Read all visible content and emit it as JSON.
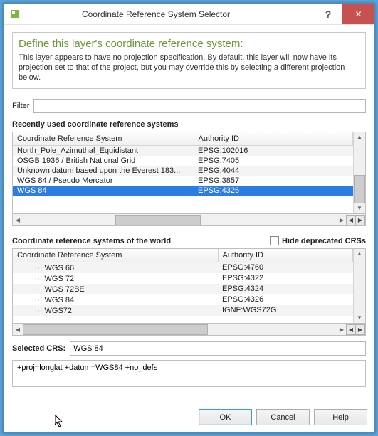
{
  "window": {
    "title": "Coordinate Reference System Selector"
  },
  "panel": {
    "title": "Define this layer's coordinate reference system:",
    "body": "This layer appears to have no projection specification. By default, this layer will now have its projection set to that of the project, but you may override this by selecting a different projection below."
  },
  "filter": {
    "label": "Filter",
    "value": ""
  },
  "recent": {
    "heading": "Recently used coordinate reference systems",
    "cols": {
      "crs": "Coordinate Reference System",
      "auth": "Authority ID"
    },
    "rows": [
      {
        "crs": "North_Pole_Azimuthal_Equidistant",
        "auth": "EPSG:102016",
        "selected": false
      },
      {
        "crs": "OSGB 1936 / British National Grid",
        "auth": "EPSG:7405",
        "selected": false
      },
      {
        "crs": "Unknown datum based upon the Everest 183...",
        "auth": "EPSG:4044",
        "selected": false
      },
      {
        "crs": "WGS 84 / Pseudo Mercator",
        "auth": "EPSG:3857",
        "selected": false
      },
      {
        "crs": "WGS 84",
        "auth": "EPSG:4326",
        "selected": true
      }
    ]
  },
  "world": {
    "heading": "Coordinate reference systems of the world",
    "hide_label": "Hide deprecated CRSs",
    "hide_checked": false,
    "cols": {
      "crs": "Coordinate Reference System",
      "auth": "Authority ID"
    },
    "rows": [
      {
        "crs": "WGS 66",
        "auth": "EPSG:4760"
      },
      {
        "crs": "WGS 72",
        "auth": "EPSG:4322"
      },
      {
        "crs": "WGS 72BE",
        "auth": "EPSG:4324"
      },
      {
        "crs": "WGS 84",
        "auth": "EPSG:4326"
      },
      {
        "crs": "WGS72",
        "auth": "IGNF:WGS72G"
      }
    ]
  },
  "selected": {
    "label": "Selected CRS:",
    "value": "WGS 84"
  },
  "proj_string": "+proj=longlat +datum=WGS84 +no_defs",
  "buttons": {
    "ok": "OK",
    "cancel": "Cancel",
    "help": "Help"
  }
}
